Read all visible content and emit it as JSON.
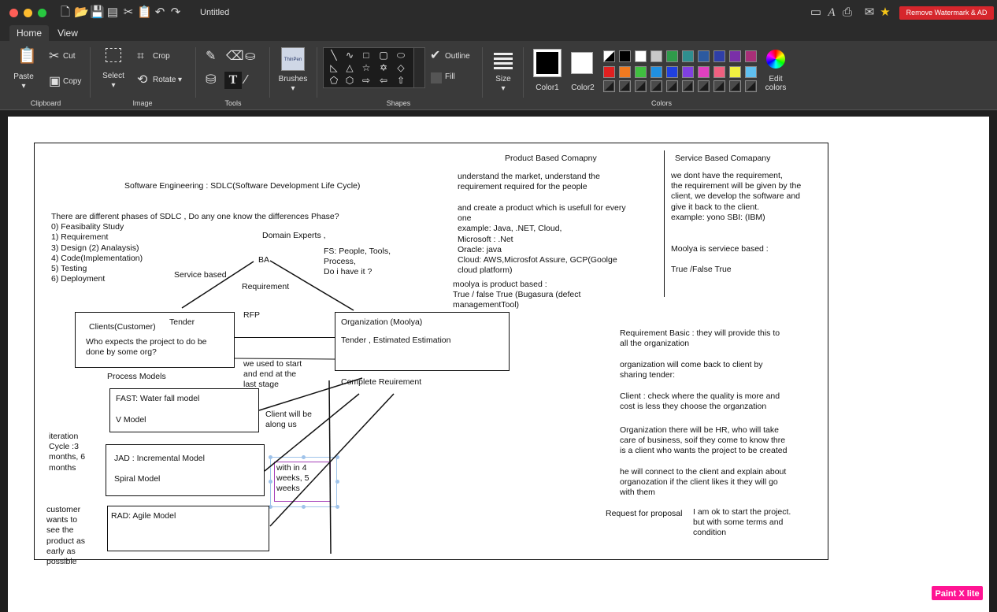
{
  "window": {
    "title": "Untitled",
    "remove_watermark_label": "Remove Watermark & AD"
  },
  "tabs": [
    {
      "label": "Home"
    },
    {
      "label": "View"
    }
  ],
  "ribbon": {
    "clipboard": {
      "paste": "Paste",
      "cut": "Cut",
      "copy": "Copy",
      "group": "Clipboard"
    },
    "image": {
      "select": "Select",
      "crop": "Crop",
      "rotate": "Rotate",
      "group": "Image"
    },
    "tools": {
      "group": "Tools"
    },
    "brushes": {
      "label": "Brushes",
      "preview": "ThinPen"
    },
    "shapes": {
      "outline": "Outline",
      "fill": "Fill",
      "group": "Shapes"
    },
    "size": {
      "label": "Size"
    },
    "colors": {
      "color1": "Color1",
      "color2": "Color2",
      "edit": "Edit\ncolors",
      "group": "Colors",
      "swatches_row1": [
        "#000000",
        "#ffffff",
        "#c8c8c8",
        "#2f9a4a",
        "#2f8f8f",
        "#2c5aa0",
        "#2f3fa8",
        "#7a2fa8",
        "#a82f78"
      ],
      "swatches_row2": [
        "#e02020",
        "#f07a20",
        "#40c040",
        "#2090e0",
        "#2040e0",
        "#8040e0",
        "#e040c0",
        "#f06080",
        "#f0f040",
        "#60c0f0"
      ]
    }
  },
  "canvas": {
    "product_header": "Product Based Comapny",
    "service_header": "Service Based Comapany",
    "sdlc_title": "Software Engineering : SDLC(Software Development Life Cycle)",
    "phases": "There are different phases of SDLC , Do any one know the differences Phase?\n0) Feasibality Study\n1) Requirement\n3) Design (2) Analaysis)\n4) Code(Implementation)\n5) Testing\n6) Deployment",
    "domain_experts": "Domain Experts ,",
    "fs_text": "FS: People, Tools,\nProcess,\nDo i have it ?",
    "ba": "BA",
    "service_based": "Service based",
    "requirement": "Requirement",
    "rfp": "RFP",
    "tender": "Tender",
    "clients_box": "Clients(Customer)",
    "clients_desc": "Who expects the project to do be\ndone by some org?",
    "org_box": "Organization (Moolya)",
    "org_tender": "Tender ,   Estimated Estimation",
    "product_text1": "understand the market, understand the\nrequirement required for the people",
    "product_text2": "and create a product which is usefull for every\none\nexample: Java, .NET, Cloud,\nMicrosoft : .Net\nOracle: java\nCloud: AWS,Microsfot Assure, GCP(Goolge\ncloud platform)",
    "moolya_product": "moolya is product based :\nTrue / false True (Bugasura (defect\nmanagementTool)",
    "service_text1": "we dont have the requirement,\nthe requirement will be given by the\nclient, we develop the software and\ngive it back to the client.\nexample: yono SBI: (IBM)",
    "moolya_service": "Moolya is serviece based :",
    "true_false": "True /False True",
    "we_used": "we used to start\nand end at the\nlast stage",
    "complete_req": "Complete Reuirement",
    "process_models": "Process Models",
    "fast": "FAST: Water fall model",
    "vmodel": "V Model",
    "client_along": "Client will be\nalong us",
    "iteration": "iteration\nCycle :3\nmonths, 6\nmonths",
    "jad": "JAD : Incremental Model",
    "spiral": "Spiral Model",
    "weeks": "with in 4\nweeks, 5\nweeks",
    "customer_wants": "customer\nwants to\nsee the\nproduct as\nearly as\npossible",
    "rad": "RAD: Agile Model",
    "req_basic": "Requirement Basic : they will provide this to\nall the organization",
    "org_come_back": "organization will come back to client by\nsharing tender:",
    "client_check": "Client : check where the quality is more and\ncost is less they choose the organzation",
    "org_hr": "Organization there will be HR, who will take\ncare of business, soif they come to know thre\nis a client who wants the project to be created",
    "he_will": "he will connect to the client and explain about\norganozation if the client likes it they will go\nwith them",
    "rfp_full": "Request for proposal",
    "ok_start": "I am ok to start the project.\nbut with some terms and\ncondition"
  },
  "badge": "Paint X lite"
}
